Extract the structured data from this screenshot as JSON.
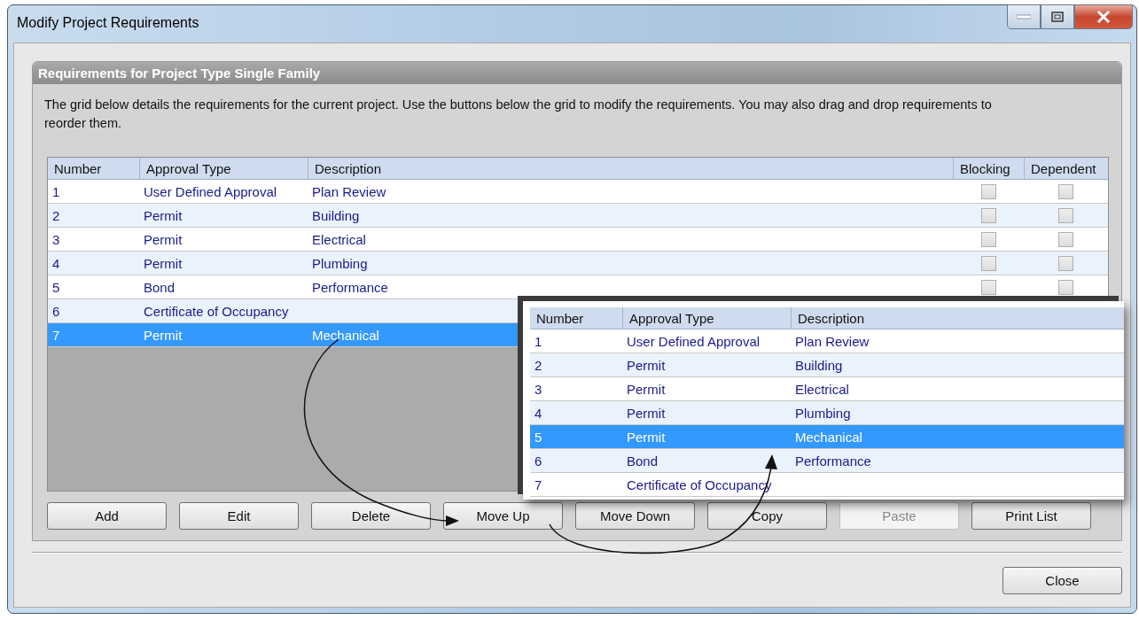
{
  "window": {
    "title": "Modify Project Requirements"
  },
  "group": {
    "title": "Requirements for Project Type  Single Family",
    "description": "The grid below details the requirements for the current project.  Use the buttons below the grid to modify the requirements. You may also drag and drop requirements to reorder them."
  },
  "grid": {
    "columns": [
      "Number",
      "Approval Type",
      "Description",
      "Blocking",
      "Dependent"
    ],
    "rows": [
      {
        "number": "1",
        "approval_type": "User Defined Approval",
        "description": "Plan Review",
        "blocking": false,
        "dependent": false,
        "selected": false
      },
      {
        "number": "2",
        "approval_type": "Permit",
        "description": "Building",
        "blocking": false,
        "dependent": false,
        "selected": false
      },
      {
        "number": "3",
        "approval_type": "Permit",
        "description": "Electrical",
        "blocking": false,
        "dependent": false,
        "selected": false
      },
      {
        "number": "4",
        "approval_type": "Permit",
        "description": "Plumbing",
        "blocking": false,
        "dependent": false,
        "selected": false
      },
      {
        "number": "5",
        "approval_type": "Bond",
        "description": "Performance",
        "blocking": false,
        "dependent": false,
        "selected": false
      },
      {
        "number": "6",
        "approval_type": "Certificate of Occupancy",
        "selected": false
      },
      {
        "number": "7",
        "approval_type": "Permit",
        "description": "Mechanical",
        "selected": true
      }
    ]
  },
  "buttons": [
    {
      "label": "Add",
      "disabled": false
    },
    {
      "label": "Edit",
      "disabled": false
    },
    {
      "label": "Delete",
      "disabled": false
    },
    {
      "label": "Move Up",
      "disabled": false
    },
    {
      "label": "Move Down",
      "disabled": false
    },
    {
      "label": "Copy",
      "disabled": false
    },
    {
      "label": "Paste",
      "disabled": true
    },
    {
      "label": "Print List",
      "disabled": false
    }
  ],
  "close_button": "Close",
  "callout": {
    "columns": [
      "Number",
      "Approval Type",
      "Description"
    ],
    "rows": [
      {
        "number": "1",
        "approval_type": "User Defined Approval",
        "description": "Plan Review",
        "selected": false
      },
      {
        "number": "2",
        "approval_type": "Permit",
        "description": "Building",
        "selected": false
      },
      {
        "number": "3",
        "approval_type": "Permit",
        "description": "Electrical",
        "selected": false
      },
      {
        "number": "4",
        "approval_type": "Permit",
        "description": "Plumbing",
        "selected": false
      },
      {
        "number": "5",
        "approval_type": "Permit",
        "description": "Mechanical",
        "selected": true
      },
      {
        "number": "6",
        "approval_type": "Bond",
        "description": "Performance",
        "selected": false
      },
      {
        "number": "7",
        "approval_type": "Certificate of Occupancy",
        "selected": false
      }
    ]
  }
}
